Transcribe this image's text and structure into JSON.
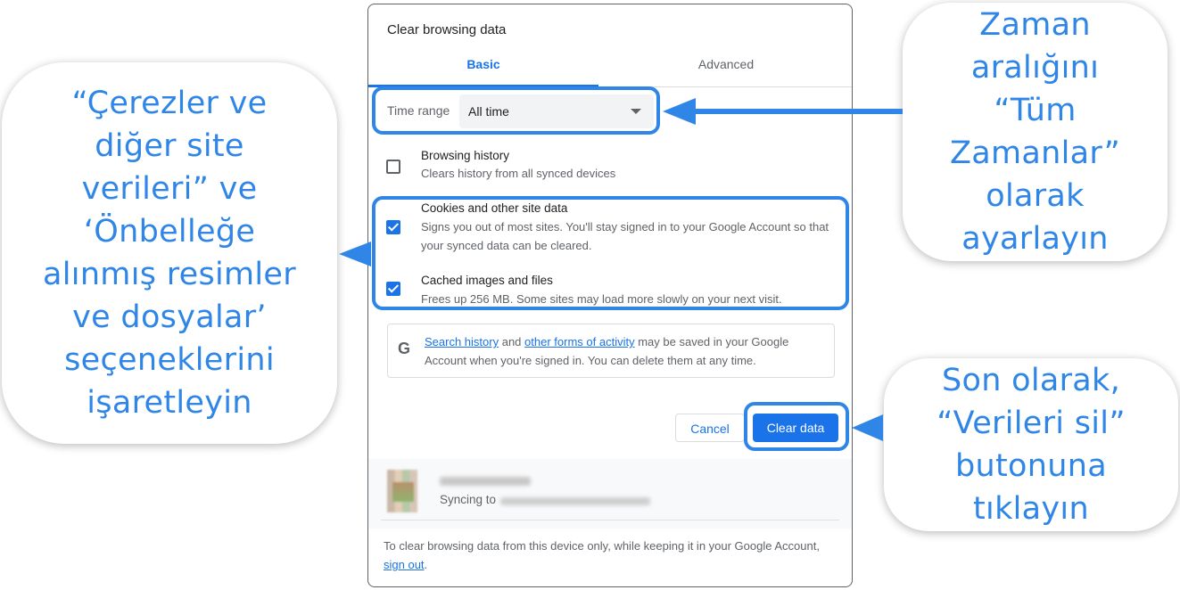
{
  "dialog": {
    "title": "Clear browsing data",
    "tabs": [
      {
        "label": "Basic",
        "selected": true
      },
      {
        "label": "Advanced",
        "selected": false
      }
    ],
    "time_range": {
      "label": "Time range",
      "value": "All time"
    },
    "options": [
      {
        "title": "Browsing history",
        "description": "Clears history from all synced devices",
        "checked": false
      },
      {
        "title": "Cookies and other site data",
        "description": "Signs you out of most sites. You'll stay signed in to your Google Account so that your synced data can be cleared.",
        "checked": true
      },
      {
        "title": "Cached images and files",
        "description": "Frees up 256 MB. Some sites may load more slowly on your next visit.",
        "checked": true
      }
    ],
    "google_notice": {
      "icon": "google-g-icon",
      "link1": "Search history",
      "and": "and",
      "link2": "other forms of activity",
      "rest": "may be saved in your Google Account when you're signed in. You can delete them at any time."
    },
    "buttons": {
      "cancel": "Cancel",
      "clear": "Clear data"
    },
    "account": {
      "syncing_label": "Syncing to"
    },
    "footer": {
      "text": "To clear browsing data from this device only, while keeping it in your Google Account,",
      "link": "sign out",
      "end": "."
    }
  },
  "callouts": {
    "left": [
      "“Çerezler ve",
      "diğer site",
      "verileri” ve",
      "‘Önbelleğe",
      "alınmış resimler",
      "ve dosyalar’",
      "seçeneklerini",
      "işaretleyin"
    ],
    "top_right": [
      "Zaman",
      "aralığını",
      "“Tüm",
      "Zamanlar”",
      "olarak",
      "ayarlayın"
    ],
    "bottom_right": [
      "Son olarak,",
      "“Verileri sil”",
      "butonuna",
      "tıklayın"
    ]
  },
  "colors": {
    "accent": "#2f86e6",
    "google_blue": "#1a73e8"
  }
}
